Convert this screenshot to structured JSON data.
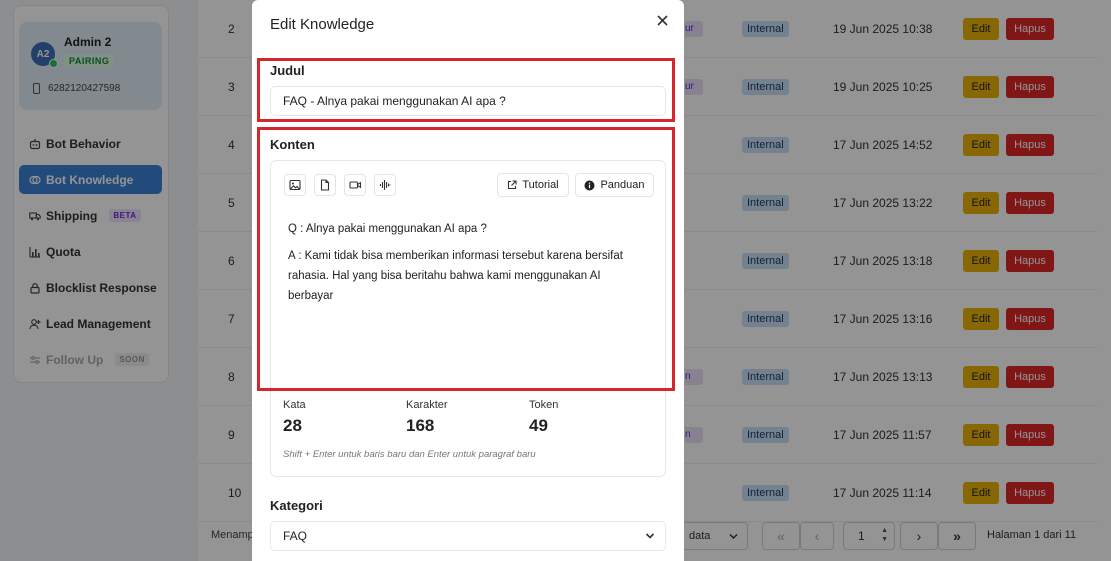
{
  "sidebar": {
    "account": {
      "initials": "A2",
      "name": "Admin 2",
      "status": "PAIRING",
      "phone": "6282120427598"
    },
    "items": [
      {
        "label": "Bot Behavior",
        "icon": "robot-icon"
      },
      {
        "label": "Bot Knowledge",
        "icon": "brain-icon"
      },
      {
        "label": "Shipping",
        "icon": "truck-icon",
        "tag": "BETA"
      },
      {
        "label": "Quota",
        "icon": "bar-chart-icon"
      },
      {
        "label": "Blocklist Response",
        "icon": "lock-icon"
      },
      {
        "label": "Lead Management",
        "icon": "user-plus-icon"
      },
      {
        "label": "Follow Up",
        "icon": "sliders-icon",
        "tag": "SOON"
      }
    ]
  },
  "table": {
    "rows": [
      {
        "num": "2",
        "cat": "ur",
        "visibility": "Internal",
        "date": "19 Jun 2025 10:38",
        "edit": "Edit",
        "delete": "Hapus"
      },
      {
        "num": "3",
        "cat": "ur",
        "visibility": "Internal",
        "date": "19 Jun 2025 10:25",
        "edit": "Edit",
        "delete": "Hapus"
      },
      {
        "num": "4",
        "cat": "",
        "visibility": "Internal",
        "date": "17 Jun 2025 14:52",
        "edit": "Edit",
        "delete": "Hapus"
      },
      {
        "num": "5",
        "cat": "",
        "visibility": "Internal",
        "date": "17 Jun 2025 13:22",
        "edit": "Edit",
        "delete": "Hapus"
      },
      {
        "num": "6",
        "cat": "",
        "visibility": "Internal",
        "date": "17 Jun 2025 13:18",
        "edit": "Edit",
        "delete": "Hapus"
      },
      {
        "num": "7",
        "cat": "",
        "visibility": "Internal",
        "date": "17 Jun 2025 13:16",
        "edit": "Edit",
        "delete": "Hapus"
      },
      {
        "num": "8",
        "cat": "n",
        "visibility": "Internal",
        "date": "17 Jun 2025 13:13",
        "edit": "Edit",
        "delete": "Hapus"
      },
      {
        "num": "9",
        "cat": "n",
        "visibility": "Internal",
        "date": "17 Jun 2025 11:57",
        "edit": "Edit",
        "delete": "Hapus"
      },
      {
        "num": "10",
        "cat": "",
        "visibility": "Internal",
        "date": "17 Jun 2025 11:14",
        "edit": "Edit",
        "delete": "Hapus"
      }
    ],
    "footer": {
      "showing": "Menamp",
      "per_page": "data",
      "page_input": "1",
      "page_info": "Halaman 1 dari 11"
    }
  },
  "modal": {
    "title": "Edit Knowledge",
    "judul_label": "Judul",
    "judul_value": "FAQ - Alnya pakai menggunakan AI apa ?",
    "konten_label": "Konten",
    "tutorial_label": "Tutorial",
    "panduan_label": "Panduan",
    "content_lines": [
      "Q : Alnya pakai menggunakan AI apa ?",
      "A : Kami tidak bisa memberikan informasi tersebut karena bersifat rahasia. Hal yang bisa beritahu bahwa kami menggunakan AI berbayar"
    ],
    "stats": {
      "kata_label": "Kata",
      "kata_value": "28",
      "karakter_label": "Karakter",
      "karakter_value": "168",
      "token_label": "Token",
      "token_value": "49"
    },
    "hint": "Shift + Enter untuk baris baru dan Enter untuk paragraf baru",
    "kategori_label": "Kategori",
    "kategori_value": "FAQ"
  },
  "colors": {
    "primary": "#3b82d6",
    "edit": "#eab308",
    "delete": "#dc2626",
    "highlight": "#d7262b",
    "badge": "#c7e0f4"
  }
}
